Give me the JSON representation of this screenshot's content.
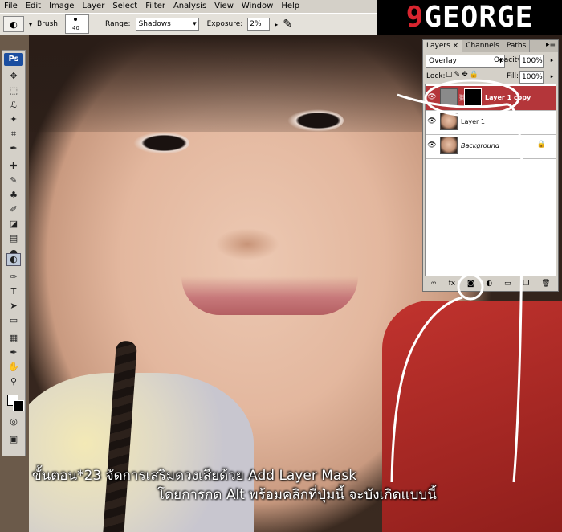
{
  "menu": [
    "File",
    "Edit",
    "Image",
    "Layer",
    "Select",
    "Filter",
    "Analysis",
    "View",
    "Window",
    "Help"
  ],
  "options": {
    "brush_label": "Brush:",
    "brush_size": "40",
    "range_label": "Range:",
    "range_value": "Shadows",
    "exposure_label": "Exposure:",
    "exposure_value": "2%"
  },
  "logo": {
    "prefix": "9",
    "text": "GEORGE"
  },
  "toolbox": {
    "logo": "Ps"
  },
  "layers_panel": {
    "tabs": [
      {
        "label": "Layers ×",
        "active": true
      },
      {
        "label": "Channels",
        "active": false
      },
      {
        "label": "Paths",
        "active": false
      }
    ],
    "blend_mode": "Overlay",
    "opacity_label": "Opacity:",
    "opacity_value": "100%",
    "lock_label": "Lock:",
    "fill_label": "Fill:",
    "fill_value": "100%",
    "layers": [
      {
        "name": "Layer 1 copy",
        "selected": true
      },
      {
        "name": "Layer 1",
        "selected": false
      },
      {
        "name": "Background",
        "selected": false
      }
    ]
  },
  "caption": {
    "line1": "ขั้นตอน*23 จัดการเสริมดวงเสียด้วย Add Layer Mask",
    "line2": "โดยการกด Alt พร้อมคลิกที่ปุ่มนี้ จะบังเกิดแบบนี้"
  },
  "colors": {
    "selected_layer": "#b4363a",
    "logo_accent": "#d8252f"
  }
}
